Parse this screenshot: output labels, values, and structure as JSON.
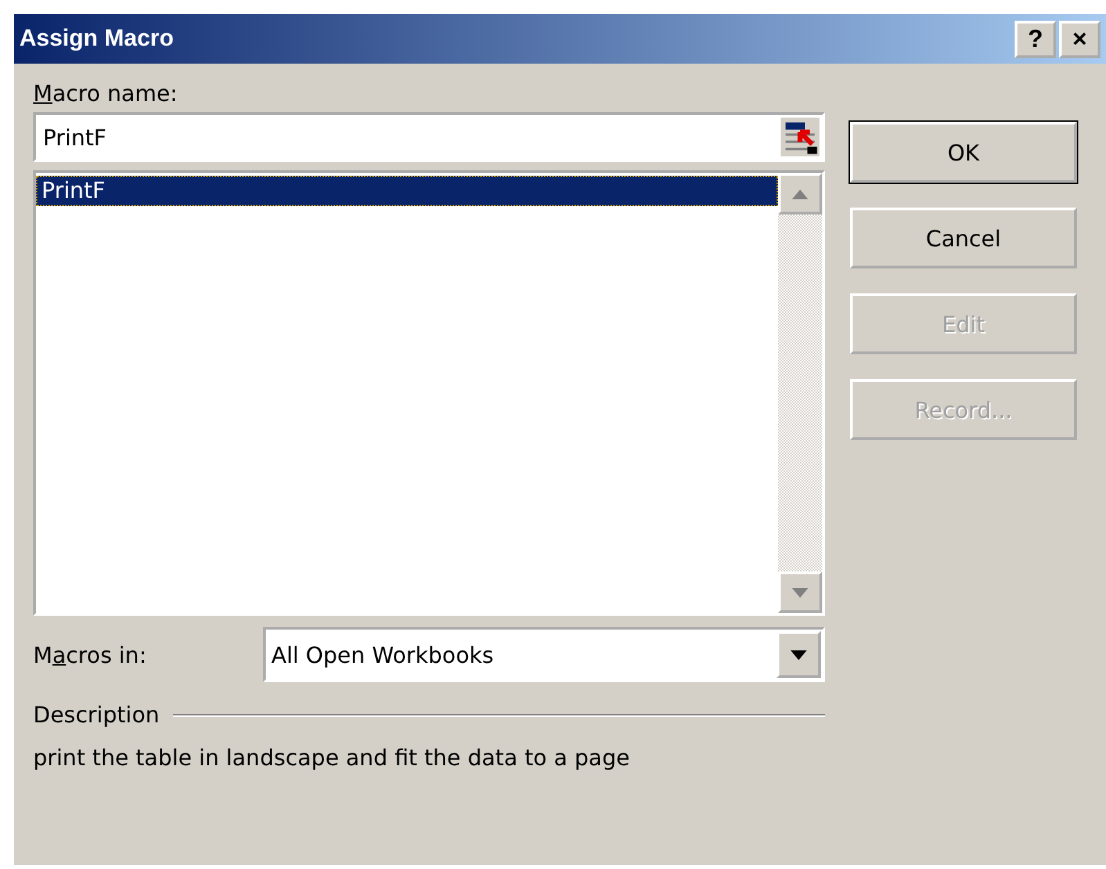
{
  "window": {
    "title": "Assign Macro",
    "help_button": "?",
    "close_button": "×"
  },
  "macro_name": {
    "label": [
      {
        "text": "M",
        "underlined": true
      },
      {
        "text": "acro name:",
        "underlined": false
      }
    ],
    "value": "PrintF"
  },
  "macros": [
    {
      "name": "PrintF",
      "selected": true
    }
  ],
  "buttons": [
    {
      "label": "OK",
      "disabled": false,
      "default": true
    },
    {
      "label": "Cancel",
      "disabled": false,
      "default": false
    },
    {
      "label": "Edit",
      "disabled": true,
      "default": false
    },
    {
      "label": "Record...",
      "disabled": true,
      "default": false
    }
  ],
  "macros_in": {
    "label": [
      {
        "text": "M",
        "underlined": false
      },
      {
        "text": "a",
        "underlined": true
      },
      {
        "text": "cros in:",
        "underlined": false
      }
    ],
    "value": "All Open Workbooks"
  },
  "description": {
    "label": "Description",
    "text": "print the table in landscape and fit the data to a page"
  }
}
